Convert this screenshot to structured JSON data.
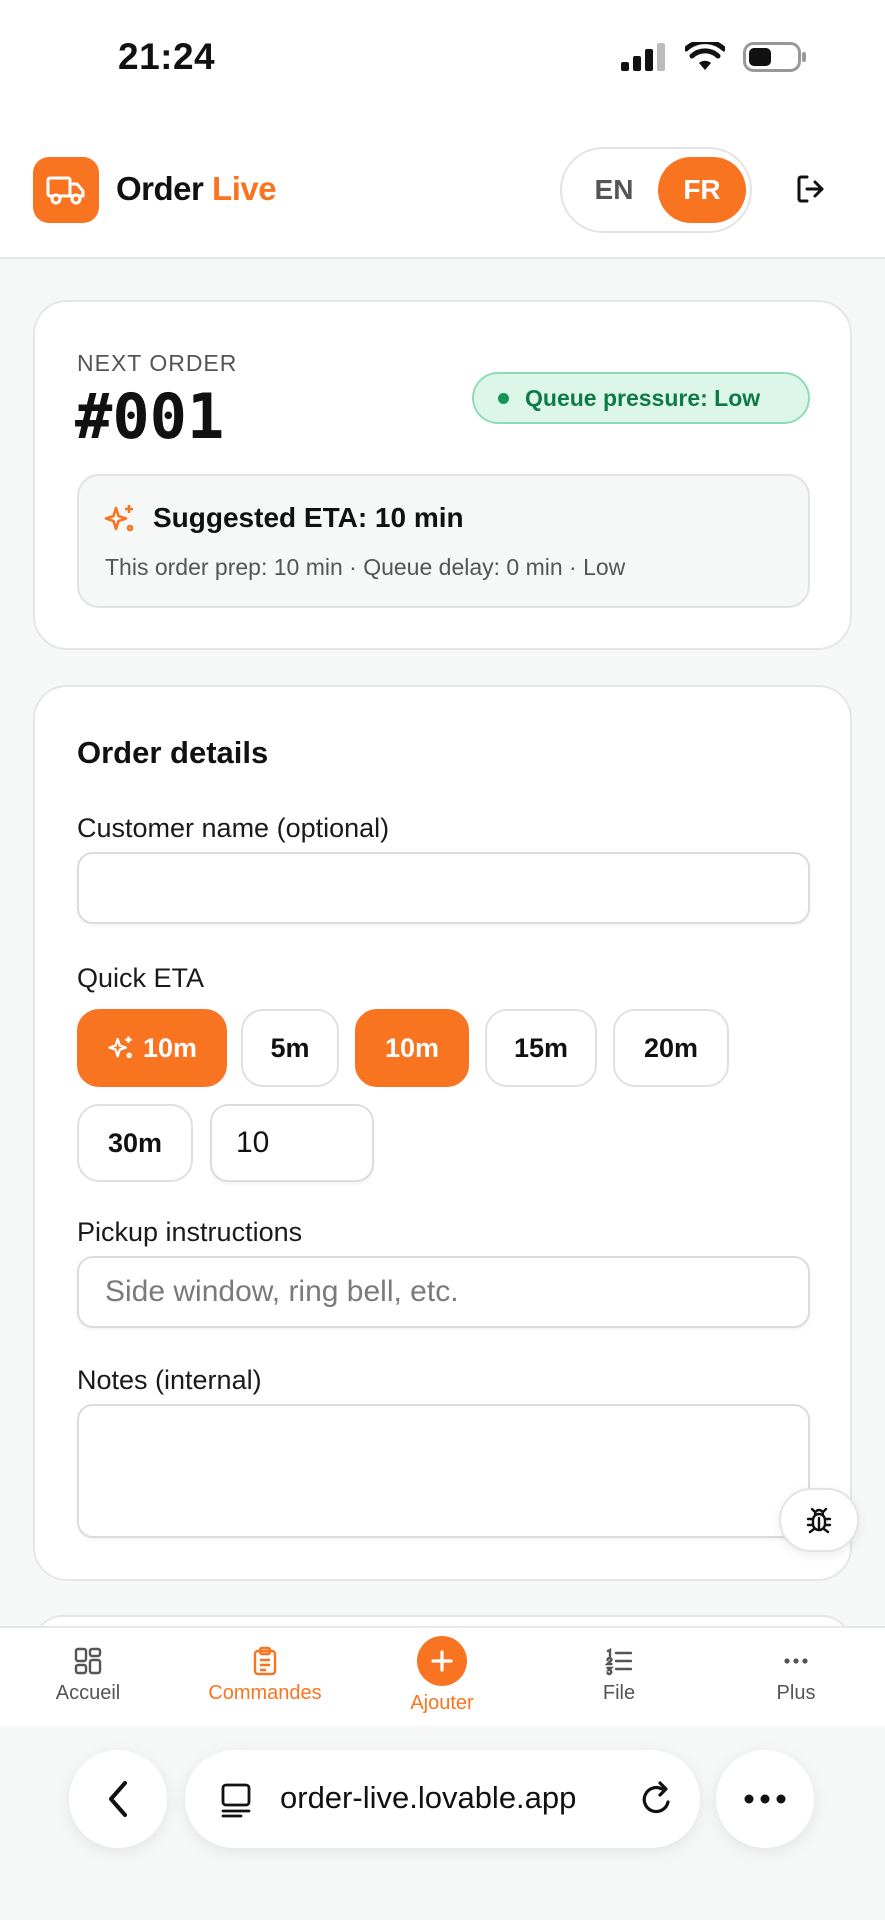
{
  "status_bar": {
    "time": "21:24"
  },
  "header": {
    "brand_first": "Order",
    "brand_accent": "Live",
    "lang_en": "EN",
    "lang_fr": "FR",
    "accent_color": "#f97420"
  },
  "next_order": {
    "label": "NEXT ORDER",
    "number": "#001",
    "queue_pressure": "Queue pressure: Low",
    "eta_title": "Suggested ETA: 10 min",
    "eta_detail": "This order prep: 10 min · Queue delay: 0 min · Low"
  },
  "order_details": {
    "title": "Order details",
    "customer_label": "Customer name (optional)",
    "customer_value": "",
    "quick_eta_label": "Quick ETA",
    "chips": [
      {
        "label": "10m",
        "active": true,
        "icon": "sparkle-icon"
      },
      {
        "label": "5m",
        "active": false
      },
      {
        "label": "10m",
        "active": true
      },
      {
        "label": "15m",
        "active": false
      },
      {
        "label": "20m",
        "active": false
      },
      {
        "label": "30m",
        "active": false
      }
    ],
    "custom_eta_value": "10",
    "pickup_label": "Pickup instructions",
    "pickup_placeholder": "Side window, ring bell, etc.",
    "notes_label": "Notes (internal)",
    "notes_value": ""
  },
  "bottom_nav": {
    "items": [
      {
        "label": "Accueil",
        "icon": "grid-icon"
      },
      {
        "label": "Commandes",
        "icon": "clipboard-icon",
        "active": true
      },
      {
        "label": "Ajouter",
        "icon": "plus-icon"
      },
      {
        "label": "File",
        "icon": "list-icon"
      },
      {
        "label": "Plus",
        "icon": "more-icon"
      }
    ]
  },
  "browser": {
    "url": "order-live.lovable.app"
  }
}
